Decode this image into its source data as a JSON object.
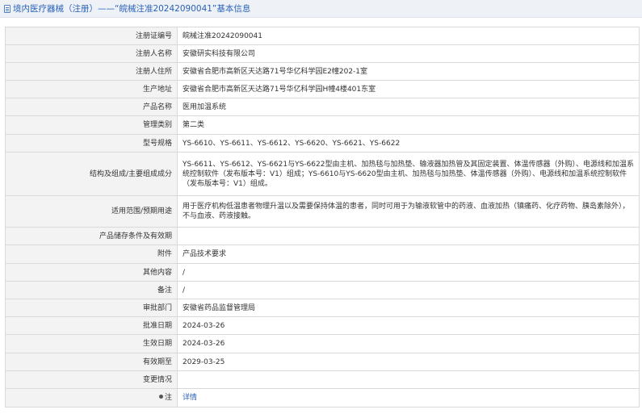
{
  "header": {
    "title": "境内医疗器械（注册）——“皖械注准20242090041”基本信息"
  },
  "rows": [
    {
      "label": "注册证编号",
      "value": "皖械注准20242090041"
    },
    {
      "label": "注册人名称",
      "value": "安徽研实科技有限公司"
    },
    {
      "label": "注册人住所",
      "value": "安徽省合肥市高新区天达路71号华亿科学园E2幢202-1室"
    },
    {
      "label": "生产地址",
      "value": "安徽省合肥市高新区天达路71号华亿科学园H幢4楼401东室"
    },
    {
      "label": "产品名称",
      "value": "医用加温系统"
    },
    {
      "label": "管理类别",
      "value": "第二类"
    },
    {
      "label": "型号规格",
      "value": "YS-6610、YS-6611、YS-6612、YS-6620、YS-6621、YS-6622"
    },
    {
      "label": "结构及组成/主要组成成分",
      "value": "YS-6611、YS-6612、YS-6621与YS-6622型由主机、加热毯与加热垫、输液器加热管及其固定装置、体温传感器（外购）、电源线和加温系统控制软件（发布版本号：V1）组成；YS-6610与YS-6620型由主机、加热毯与加热垫、体温传感器（外购）、电源线和加温系统控制软件（发布版本号：V1）组成。"
    },
    {
      "label": "适用范围/预期用途",
      "value": "用于医疗机构低温患者物理升温以及需要保持体温的患者，同时可用于为输液软管中的药液、血液加热（镇痛药、化疗药物、胰岛素除外），不与血液、药液接触。"
    },
    {
      "label": "产品储存条件及有效期",
      "value": ""
    },
    {
      "label": "附件",
      "value": "产品技术要求"
    },
    {
      "label": "其他内容",
      "value": "/"
    },
    {
      "label": "备注",
      "value": "/"
    },
    {
      "label": "审批部门",
      "value": "安徽省药品监督管理局"
    },
    {
      "label": "批准日期",
      "value": "2024-03-26"
    },
    {
      "label": "生效日期",
      "value": "2024-03-26"
    },
    {
      "label": "有效期至",
      "value": "2029-03-25"
    },
    {
      "label": "变更情况",
      "value": ""
    },
    {
      "label": "注",
      "value": "详情"
    }
  ]
}
